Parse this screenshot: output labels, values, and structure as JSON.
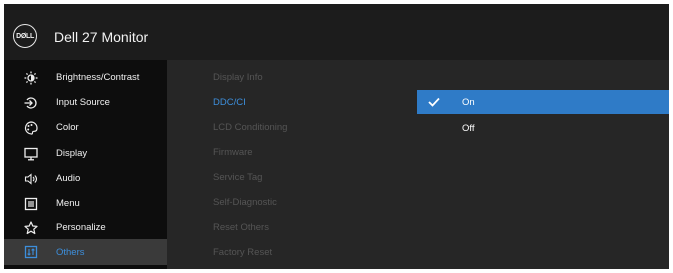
{
  "header": {
    "logo_text": "DØLL",
    "model": "Dell 27 Monitor"
  },
  "sidebar": {
    "items": [
      {
        "label": "Brightness/Contrast",
        "icon": "brightness-icon"
      },
      {
        "label": "Input Source",
        "icon": "input-source-icon"
      },
      {
        "label": "Color",
        "icon": "color-palette-icon"
      },
      {
        "label": "Display",
        "icon": "display-icon"
      },
      {
        "label": "Audio",
        "icon": "speaker-icon"
      },
      {
        "label": "Menu",
        "icon": "menu-icon"
      },
      {
        "label": "Personalize",
        "icon": "star-icon"
      },
      {
        "label": "Others",
        "icon": "others-icon",
        "active": true
      }
    ]
  },
  "submenu": {
    "items": [
      {
        "label": "Display Info"
      },
      {
        "label": "DDC/CI",
        "selected": true
      },
      {
        "label": "LCD Conditioning"
      },
      {
        "label": "Firmware"
      },
      {
        "label": "Service Tag"
      },
      {
        "label": "Self-Diagnostic"
      },
      {
        "label": "Reset Others"
      },
      {
        "label": "Factory Reset"
      }
    ]
  },
  "options": {
    "items": [
      {
        "label": "On",
        "checked": true
      },
      {
        "label": "Off",
        "checked": false
      }
    ]
  },
  "colors": {
    "accent": "#3d8fdc",
    "highlight": "#2f7bc7",
    "panel": "#262626",
    "sidebar": "#0d0d0d"
  }
}
